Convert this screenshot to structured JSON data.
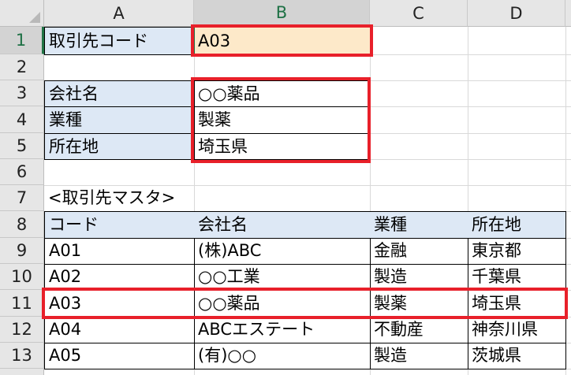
{
  "columns": [
    "A",
    "B",
    "C",
    "D"
  ],
  "rows": [
    "1",
    "2",
    "3",
    "4",
    "5",
    "6",
    "7",
    "8",
    "9",
    "10",
    "11",
    "12",
    "13"
  ],
  "lookup": {
    "code_label": "取引先コード",
    "code_value": "A03",
    "fields": [
      {
        "label": "会社名",
        "value": "○○薬品"
      },
      {
        "label": "業種",
        "value": "製薬"
      },
      {
        "label": "所在地",
        "value": "埼玉県"
      }
    ]
  },
  "master": {
    "title": "<取引先マスタ>",
    "headers": [
      "コード",
      "会社名",
      "業種",
      "所在地"
    ],
    "rows": [
      [
        "A01",
        "(株)ABC",
        "金融",
        "東京都"
      ],
      [
        "A02",
        "○○工業",
        "製造",
        "千葉県"
      ],
      [
        "A03",
        "○○薬品",
        "製薬",
        "埼玉県"
      ],
      [
        "A04",
        "ABCエステート",
        "不動産",
        "神奈川県"
      ],
      [
        "A05",
        "(有)○○",
        "製造",
        "茨城県"
      ]
    ]
  },
  "colors": {
    "header_fill": "#dde8f5",
    "input_fill": "#fde9c9",
    "highlight": "#e8202a",
    "selection": "#217346"
  }
}
